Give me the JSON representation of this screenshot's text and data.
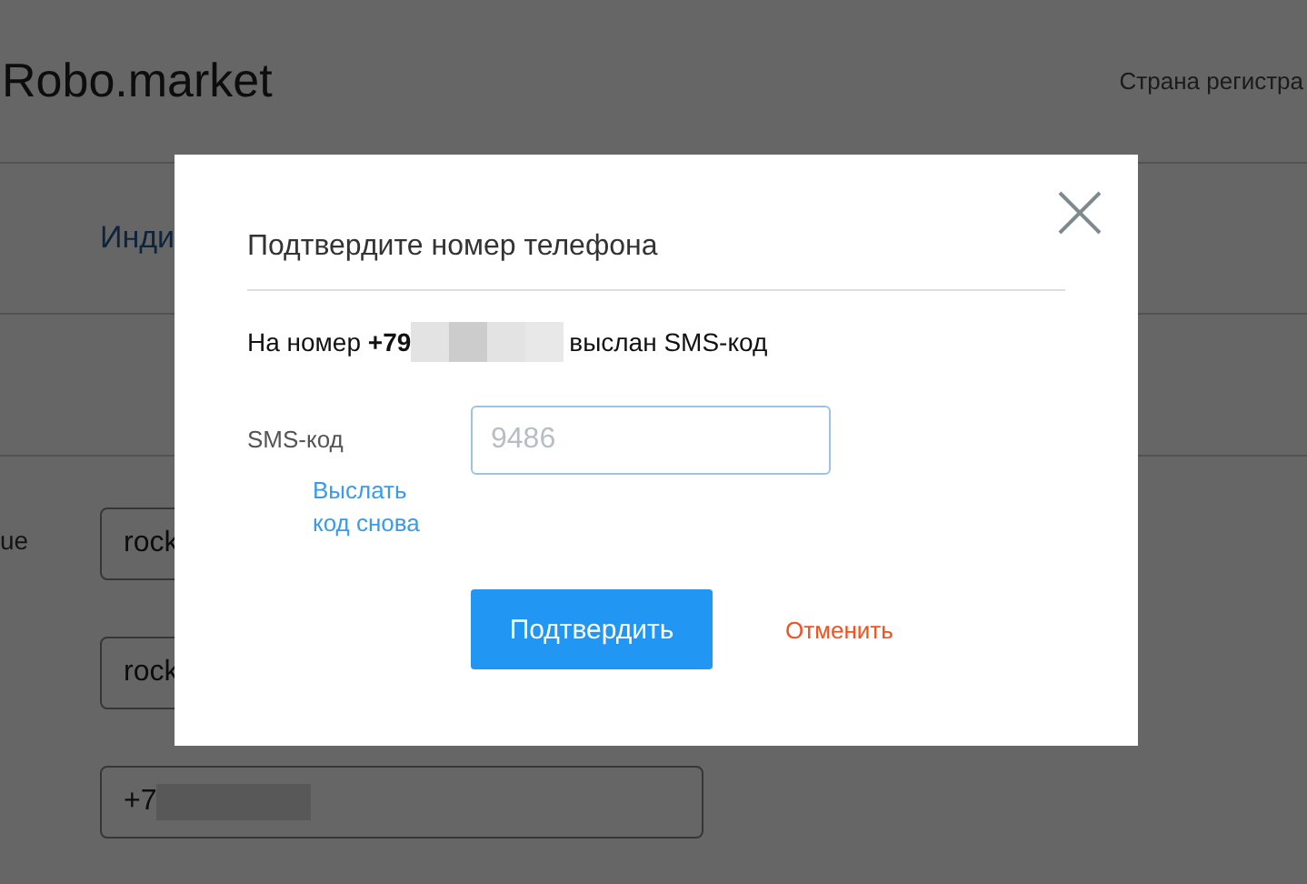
{
  "page": {
    "logo": "Robo.market",
    "header_link": "Страна регистра",
    "tab": "Инди",
    "form_label": "ue",
    "fields": [
      {
        "value": "rock"
      },
      {
        "value": "rock"
      },
      {
        "value": "+7",
        "redacted": true
      }
    ]
  },
  "dialog": {
    "title": "Подтвердите номер телефона",
    "message_start": "На номер **+79**",
    "phone_redacted": true,
    "message_end": "выслан SMS-код",
    "code_label": "SMS-код",
    "code_field": {
      "placeholder": "9486"
    },
    "resend_link": "Выслать код снова",
    "confirm_button": "Подтвердить",
    "cancel_link": "Отменить"
  }
}
